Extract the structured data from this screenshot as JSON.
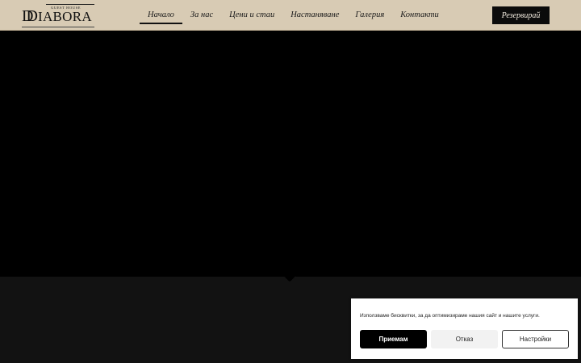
{
  "logo": {
    "tagline": "GUEST HOUSE",
    "monogram": "D",
    "wordmark": "IABORA"
  },
  "nav": {
    "items": [
      {
        "label": "Начало",
        "active": true
      },
      {
        "label": "За нас",
        "active": false
      },
      {
        "label": "Цени и стаи",
        "active": false
      },
      {
        "label": "Настаняване",
        "active": false
      },
      {
        "label": "Галерия",
        "active": false
      },
      {
        "label": "Контакти",
        "active": false
      }
    ]
  },
  "header": {
    "reserve_label": "Резервирай"
  },
  "cookie_banner": {
    "message": "Използваме бисквитки, за да оптимизираме нашия сайт и нашите услуги.",
    "accept_label": "Приемам",
    "deny_label": "Отказ",
    "settings_label": "Настройки"
  },
  "colors": {
    "header_bg": "#d8cbb4",
    "hero_bg": "#000000",
    "lower_bg": "#121212",
    "button_bg": "#0b0b0b"
  }
}
